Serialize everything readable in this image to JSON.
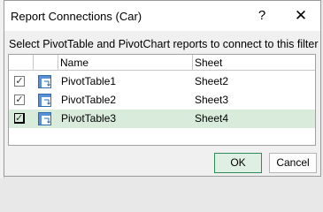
{
  "dialog": {
    "title": "Report Connections (Car)",
    "help": "?",
    "close": "✕",
    "instructions": "Select PivotTable and PivotChart reports to connect to this filter"
  },
  "table": {
    "columns": [
      "",
      "",
      "Name",
      "Sheet"
    ],
    "rows": [
      {
        "checked": "✓",
        "name": "PivotTable1",
        "sheet": "Sheet2"
      },
      {
        "checked": "✓",
        "name": "PivotTable2",
        "sheet": "Sheet3"
      },
      {
        "checked": "✓",
        "name": "PivotTable3",
        "sheet": "Sheet4"
      }
    ]
  },
  "buttons": {
    "ok": "OK",
    "cancel": "Cancel"
  },
  "colors": {
    "selected_row": "#d9ecdc",
    "ok_border": "#2e8b57"
  }
}
